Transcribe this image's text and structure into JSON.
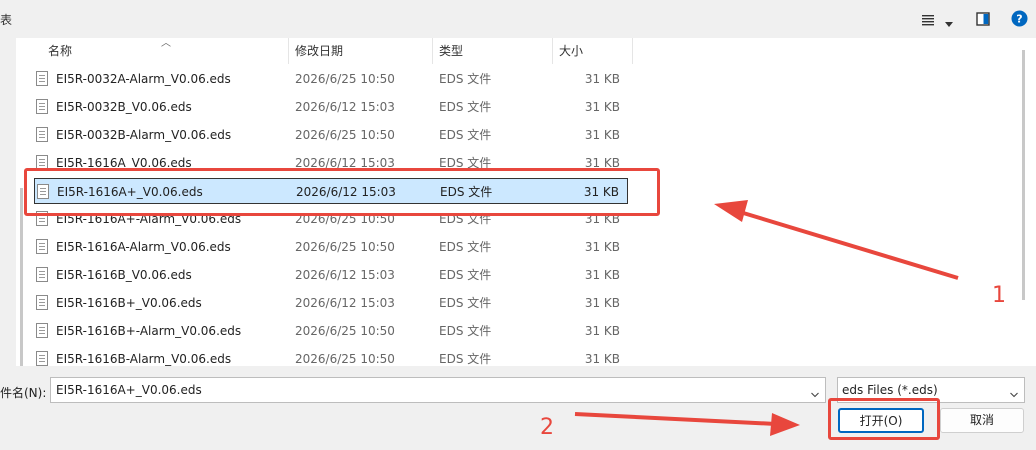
{
  "window": {
    "title_fragment": "表"
  },
  "toolbar": {
    "view_menu_icon": "list-view-icon",
    "preview_pane_icon": "preview-pane-icon",
    "help_icon": "help-icon",
    "help_glyph": "?",
    "accent_color": "#0067c0"
  },
  "columns": {
    "name": "名称",
    "date": "修改日期",
    "type": "类型",
    "size": "大小"
  },
  "files": [
    {
      "name": "EI5R-0032A-Alarm_V0.06.eds",
      "date": "2026/6/25 10:50",
      "type": "EDS 文件",
      "size": "31 KB"
    },
    {
      "name": "EI5R-0032B_V0.06.eds",
      "date": "2026/6/12 15:03",
      "type": "EDS 文件",
      "size": "31 KB"
    },
    {
      "name": "EI5R-0032B-Alarm_V0.06.eds",
      "date": "2026/6/25 10:50",
      "type": "EDS 文件",
      "size": "31 KB"
    },
    {
      "name": "EI5R-1616A_V0.06.eds",
      "date": "2026/6/12 15:03",
      "type": "EDS 文件",
      "size": "31 KB"
    },
    {
      "name": "EI5R-1616A+_V0.06.eds",
      "date": "2026/6/12 15:03",
      "type": "EDS 文件",
      "size": "31 KB"
    },
    {
      "name": "EI5R-1616A+-Alarm_V0.06.eds",
      "date": "2026/6/25 10:50",
      "type": "EDS 文件",
      "size": "31 KB"
    },
    {
      "name": "EI5R-1616A-Alarm_V0.06.eds",
      "date": "2026/6/25 10:50",
      "type": "EDS 文件",
      "size": "31 KB"
    },
    {
      "name": "EI5R-1616B_V0.06.eds",
      "date": "2026/6/12 15:03",
      "type": "EDS 文件",
      "size": "31 KB"
    },
    {
      "name": "EI5R-1616B+_V0.06.eds",
      "date": "2026/6/12 15:03",
      "type": "EDS 文件",
      "size": "31 KB"
    },
    {
      "name": "EI5R-1616B+-Alarm_V0.06.eds",
      "date": "2026/6/25 10:50",
      "type": "EDS 文件",
      "size": "31 KB"
    },
    {
      "name": "EI5R-1616B-Alarm_V0.06.eds",
      "date": "2026/6/25 10:50",
      "type": "EDS 文件",
      "size": "31 KB"
    }
  ],
  "selected_index": 4,
  "filename": {
    "label": "件名(N):",
    "value": "EI5R-1616A+_V0.06.eds"
  },
  "filetype": {
    "value": "eds Files (*.eds)"
  },
  "buttons": {
    "open": "打开(O)",
    "cancel": "取消"
  },
  "annotations": {
    "step1": "1",
    "step2": "2",
    "color": "#e8473d"
  }
}
